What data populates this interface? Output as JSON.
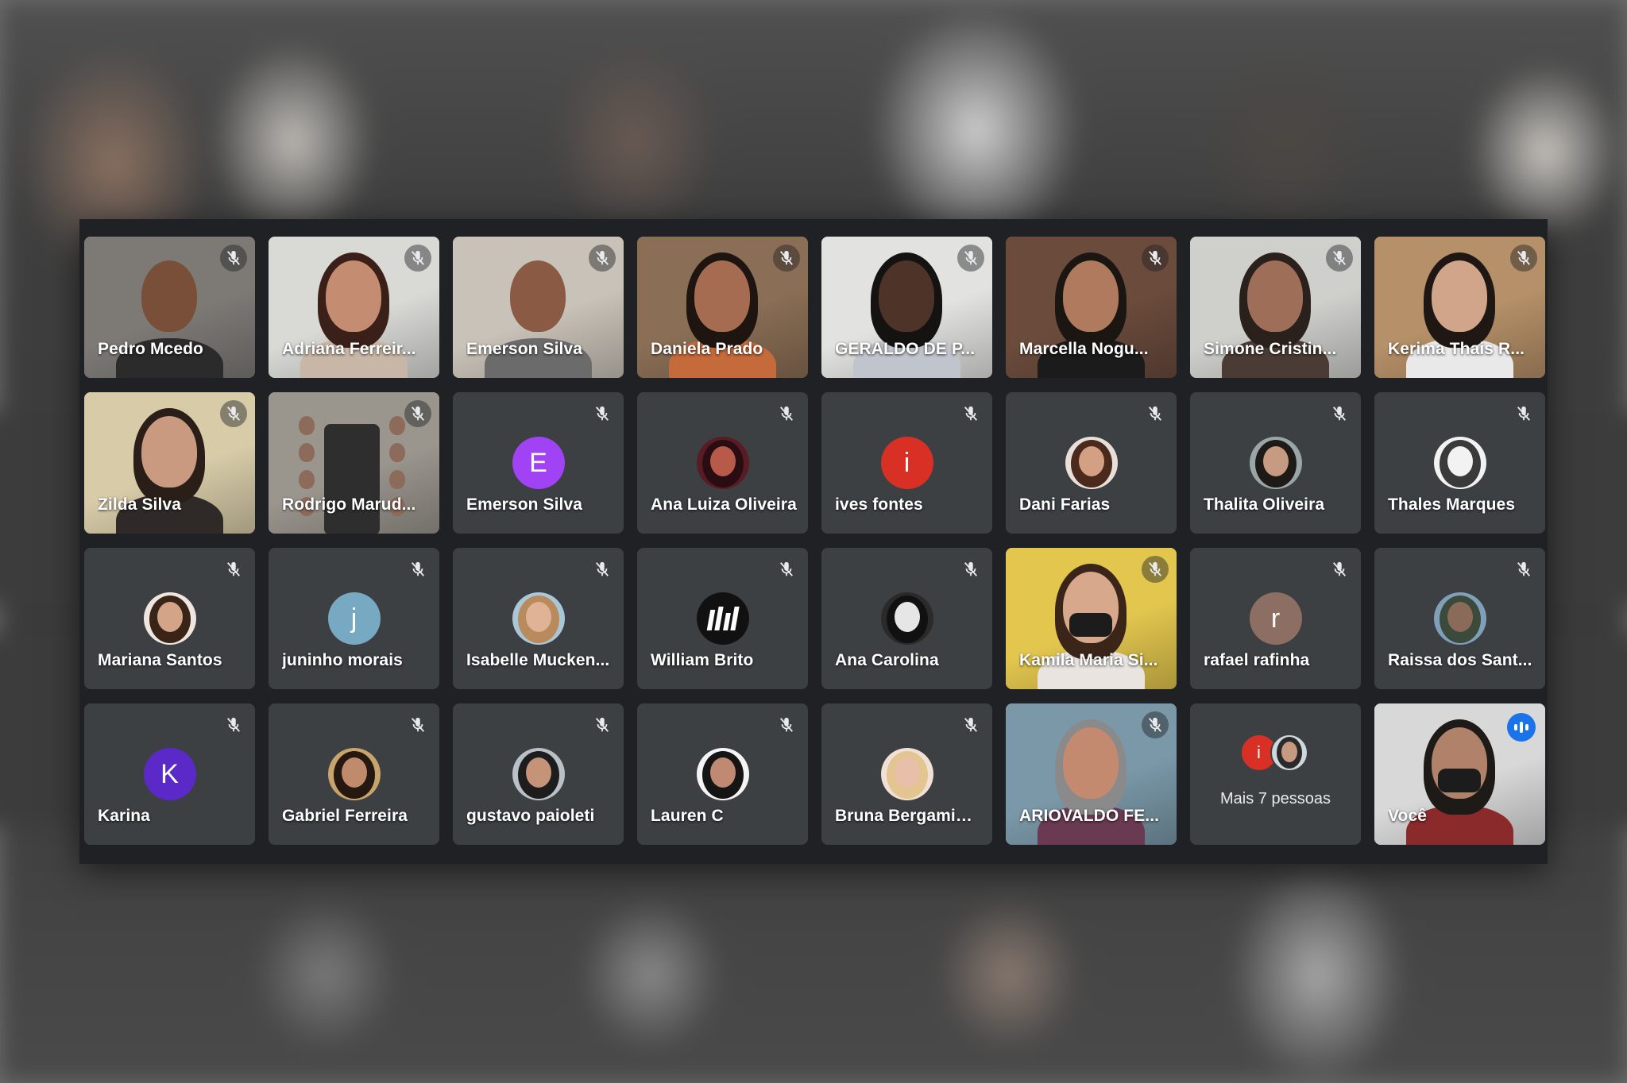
{
  "meeting": {
    "participants": [
      {
        "name": "Pedro Mcedo",
        "kind": "video",
        "scene": {
          "bg": "#7d7a76",
          "skin": "#7a4f3a",
          "hair": "#2a211c",
          "shirt": "#2b2b2b",
          "bald": true
        }
      },
      {
        "name": "Adriana Ferreir...",
        "kind": "video",
        "scene": {
          "bg": "#d9d9d6",
          "skin": "#c48d72",
          "hair": "#3a2018",
          "shirt": "#c8b7a6"
        }
      },
      {
        "name": "Emerson Silva",
        "kind": "video",
        "scene": {
          "bg": "#c9c2b8",
          "skin": "#8a5a44",
          "hair": "#1b1512",
          "shirt": "#6b6b6b",
          "bald": true
        }
      },
      {
        "name": "Daniela Prado",
        "kind": "video",
        "scene": {
          "bg": "#8a6e55",
          "skin": "#a66c52",
          "hair": "#1e1410",
          "shirt": "#c46a3b"
        }
      },
      {
        "name": "GERALDO DE P...",
        "kind": "video",
        "scene": {
          "bg": "#e2e2e0",
          "skin": "#4e3328",
          "hair": "#151312",
          "shirt": "#c0c4cc"
        }
      },
      {
        "name": "Marcella Nogu...",
        "kind": "video",
        "scene": {
          "bg": "#6a4b3c",
          "skin": "#b07a5e",
          "hair": "#1c1612",
          "shirt": "#1b1b1b"
        }
      },
      {
        "name": "Simone Cristin...",
        "kind": "video",
        "scene": {
          "bg": "#cfcfcc",
          "skin": "#9e6e58",
          "hair": "#2b211c",
          "shirt": "#4a3c34"
        }
      },
      {
        "name": "Kerima Thais R...",
        "kind": "video",
        "scene": {
          "bg": "#b59068",
          "skin": "#d0a58a",
          "hair": "#1e1714",
          "shirt": "#e9e9e9"
        }
      },
      {
        "name": "Zilda Silva",
        "kind": "video",
        "scene": {
          "bg": "#d7cba8",
          "skin": "#c99a80",
          "hair": "#2a1e18",
          "shirt": "#2f2a28"
        }
      },
      {
        "name": "Rodrigo Marud...",
        "kind": "video",
        "scene": {
          "bg": "#9a958d",
          "skin": "#8d6b5a",
          "hair": "#2c2c2c",
          "shirt": "#3a3a3a",
          "group": true
        }
      },
      {
        "name": "Emerson Silva",
        "kind": "letter",
        "letter": "E",
        "color": "#a142f4"
      },
      {
        "name": "Ana Luiza Oliveira",
        "kind": "photo",
        "photo": {
          "bg": "#5a1c24",
          "face": "#b85a4a",
          "hair": "#2a0d12"
        }
      },
      {
        "name": "ives fontes",
        "kind": "letter",
        "letter": "i",
        "color": "#d93025"
      },
      {
        "name": "Dani Farias",
        "kind": "photo",
        "photo": {
          "bg": "#e8dfd8",
          "face": "#d4a083",
          "hair": "#4a2a1c"
        }
      },
      {
        "name": "Thalita Oliveira",
        "kind": "photo",
        "photo": {
          "bg": "#9aa5a8",
          "face": "#c79a82",
          "hair": "#1e1a18"
        }
      },
      {
        "name": "Thales Marques",
        "kind": "photo",
        "photo": {
          "bg": "#f2f2f2",
          "face": "#f2f2f2",
          "hair": "#3a3a3a"
        }
      },
      {
        "name": "Mariana Santos",
        "kind": "photo",
        "photo": {
          "bg": "#f0e6df",
          "face": "#d3a487",
          "hair": "#3a2418"
        }
      },
      {
        "name": "juninho morais",
        "kind": "letter",
        "letter": "j",
        "color": "#78a9c2"
      },
      {
        "name": "Isabelle Mucken...",
        "kind": "photo",
        "photo": {
          "bg": "#a9c7d6",
          "face": "#e0b396",
          "hair": "#b98a5c"
        }
      },
      {
        "name": "William Brito",
        "kind": "logo",
        "photo": {
          "bg": "#111111",
          "face": "#ffffff",
          "hair": "#111111"
        }
      },
      {
        "name": "Ana Carolina",
        "kind": "photo",
        "photo": {
          "bg": "#2a2a2a",
          "face": "#e6e6e6",
          "hair": "#111111"
        }
      },
      {
        "name": "Kamila Maria Si...",
        "kind": "video",
        "scene": {
          "bg": "#e2c64e",
          "skin": "#d7a88c",
          "hair": "#3a2518",
          "shirt": "#e9e4e0",
          "masked": true
        }
      },
      {
        "name": "rafael rafinha",
        "kind": "letter",
        "letter": "r",
        "color": "#8d6e63"
      },
      {
        "name": "Raissa dos Sant...",
        "kind": "photo",
        "photo": {
          "bg": "#7fa0b8",
          "face": "#8a6a58",
          "hair": "#3b4a3a"
        }
      },
      {
        "name": "Karina",
        "kind": "letter",
        "letter": "K",
        "color": "#5b29c7"
      },
      {
        "name": "Gabriel Ferreira",
        "kind": "photo",
        "photo": {
          "bg": "#c9a36c",
          "face": "#c08a6c",
          "hair": "#241810"
        }
      },
      {
        "name": "gustavo paioleti",
        "kind": "photo",
        "photo": {
          "bg": "#b8c0c8",
          "face": "#c59478",
          "hair": "#1d1d1d"
        }
      },
      {
        "name": "Lauren C",
        "kind": "photo",
        "photo": {
          "bg": "#f4f4f4",
          "face": "#c08a72",
          "hair": "#151515"
        }
      },
      {
        "name": "Bruna Bergamin ...",
        "kind": "photo",
        "photo": {
          "bg": "#f1e0d6",
          "face": "#e8bfa8",
          "hair": "#e2c590"
        }
      },
      {
        "name": "ARIOVALDO FE...",
        "kind": "video",
        "scene": {
          "bg": "#7a98a8",
          "skin": "#c48a70",
          "hair": "#8a8a8a",
          "shirt": "#6a3a52"
        }
      },
      {
        "name": "Mais 7 pessoas",
        "kind": "more",
        "mini": [
          {
            "letter": "i",
            "color": "#d93025"
          },
          {
            "photo": {
              "bg": "#cfd8dc",
              "face": "#c59a80",
              "hair": "#2a2a2a"
            }
          }
        ]
      },
      {
        "name": "Você",
        "kind": "self",
        "scene": {
          "bg": "#d8d8d8",
          "skin": "#b0826a",
          "hair": "#1d1a18",
          "shirt": "#8b2a2a",
          "masked": true
        }
      }
    ]
  }
}
